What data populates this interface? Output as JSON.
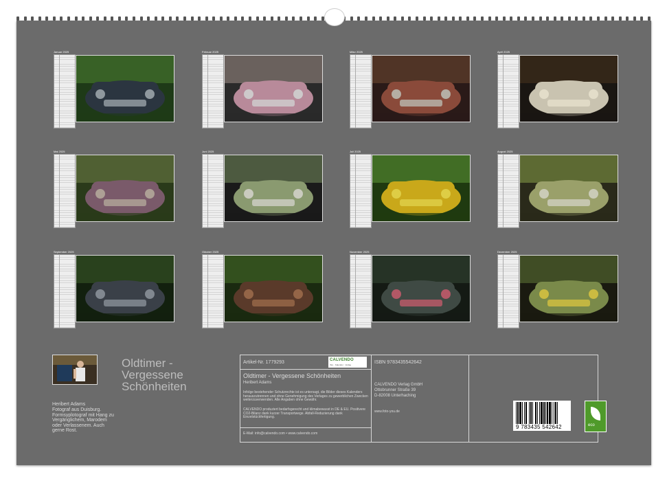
{
  "months": [
    {
      "label": "Januar 2025",
      "scene": "car-front-green"
    },
    {
      "label": "Februar 2025",
      "scene": "car-hood-pink"
    },
    {
      "label": "März 2025",
      "scene": "car-hood-red"
    },
    {
      "label": "April 2025",
      "scene": "car-white-front"
    },
    {
      "label": "Mai 2025",
      "scene": "car-fender-blur"
    },
    {
      "label": "Juni 2025",
      "scene": "car-headlight"
    },
    {
      "label": "Juli 2025",
      "scene": "car-yellow-forest"
    },
    {
      "label": "August 2025",
      "scene": "car-moss-grille"
    },
    {
      "label": "September 2025",
      "scene": "car-dark-forest"
    },
    {
      "label": "Oktober 2025",
      "scene": "car-rust-forest"
    },
    {
      "label": "November 2025",
      "scene": "car-dark-front"
    },
    {
      "label": "Dezember 2025",
      "scene": "car-grille-plate"
    }
  ],
  "author": {
    "name": "Heribert Adams",
    "description": "Fotograf aus Duisburg. Formsyplotograf mit Hang zu Vergänglichem, Marodem oder Verlassenem. Auch gerne Rost."
  },
  "title": "Oldtimer - Vergessene Schönheiten",
  "info": {
    "article": "Artikel-Nr. 1779293",
    "title": "Oldtimer - Vergessene Schönheiten",
    "author": "Heribert Adams",
    "legal": "Infolge bestehender Schutzrechte ist es untersagt, die Bilder dieses Kalenders herauszutrennen und ohne Genehmigung des Verlages zu gewerblichen Zwecken weiterzuverwenden. Alle Angaben ohne Gewähr.",
    "eco_note": "CALVENDO produziert bedarfsgerecht und klimabewusst in DE & EU. Positivere CO2-Bilanz dank kurzer Transportwege. Abfall-Reduzierung dank Einzelstückfertigung.",
    "contact": "E-Mail: info@calvendo.com • www.calvendo.com",
    "isbn": "ISBN 9783435542642",
    "publisher": "CALVENDO Verlag GmbH",
    "street": "Ottobrunner Straße 39",
    "city": "D-82008 Unterhaching",
    "website": "www.foto-you.de",
    "logo_text": "CALVENDO",
    "logo_sub": "Ihre · Kalender · Verlag"
  },
  "barcode_number": "9 783435 542642",
  "eco_label": "eco",
  "colors": {
    "page": "#6b6b6b",
    "eco": "#4f9a2a"
  }
}
